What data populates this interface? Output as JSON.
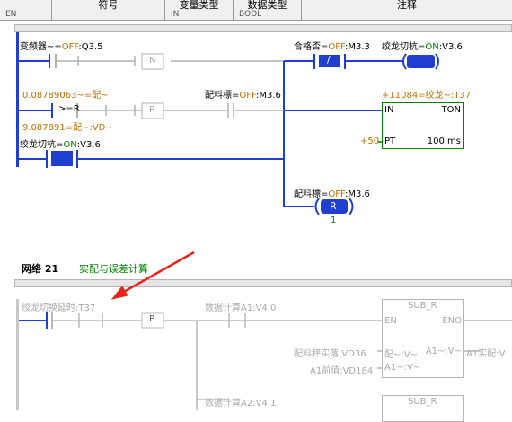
{
  "table_header": {
    "row_label": "EN",
    "columns": [
      {
        "title": "符号",
        "value": ""
      },
      {
        "title": "变量类型",
        "value": "IN"
      },
      {
        "title": "数据类型",
        "value": "BOOL"
      },
      {
        "title": "注释",
        "value": ""
      }
    ]
  },
  "rung1": {
    "contact_inverter": {
      "name": "变频器~",
      "eq": "=",
      "state": "OFF",
      "addr": ":Q3.5"
    },
    "n_label": "N",
    "contact_pass": {
      "name": "合格否",
      "eq": "=",
      "state": "OFF",
      "addr": ":M3.3"
    },
    "not_symbol": "/",
    "coil_auger": {
      "name": "绞龙切杭",
      "eq": "=",
      "state": "ON",
      "addr": ":V3.6"
    },
    "compare_in1": "0.08789063~=配~:",
    "compare_op": ">=R",
    "compare_in2": "9.087891=配~:VD~",
    "p_label": "P",
    "contact_batch": {
      "name": "配料標",
      "eq": "=",
      "state": "OFF",
      "addr": ":M3.6"
    },
    "timer_value": "+11084=绞龙~:T37",
    "timer_in": "IN",
    "timer_type": "TON",
    "timer_pt_value": "+50",
    "timer_pt": "PT",
    "timer_base": "100 ms",
    "contact_auger2": {
      "name": "绞龙切杭",
      "eq": "=",
      "state": "ON",
      "addr": ":V3.6"
    },
    "reset_coil": {
      "name": "配料標",
      "eq": "=",
      "state": "OFF",
      "addr": ":M3.6"
    },
    "reset_symbol": "R",
    "reset_count": "1"
  },
  "network21": {
    "title": "网络 21",
    "comment": "实配与误差计算",
    "contact_delay": "绞龙切换延时:T37",
    "p_label": "P",
    "contact_calc1": "数据计算A1:V4.0",
    "box1": {
      "title": "SUB_R",
      "en": "EN",
      "eno": "ENO",
      "in1_label": "配料秤实落:VD36",
      "in1": "配~:V~",
      "in2_label": "A1前值:VD184",
      "in2": "A1~:V~",
      "out": "A1~:V~",
      "out_label": "A1实配:V"
    },
    "contact_calc2": "数据计算A2:V4.1",
    "box2": {
      "title": "SUB_R"
    }
  },
  "colors": {
    "power": "#1f3fd0",
    "green": "#008000",
    "state": "#c07000",
    "arrow": "#e8251d"
  }
}
